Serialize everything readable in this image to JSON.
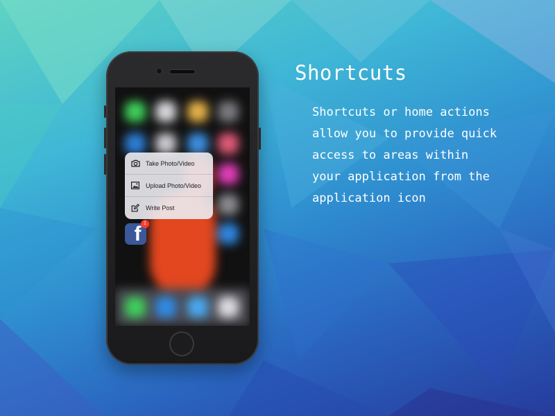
{
  "heading": {
    "title": "Shortcuts",
    "description_lines": [
      "Shortcuts or home actions",
      "allow you to provide quick",
      "access to areas within",
      "your application from the",
      "application icon"
    ]
  },
  "quick_actions": {
    "items": [
      {
        "label": "Take Photo/Video",
        "icon": "camera-icon"
      },
      {
        "label": "Upload Photo/Video",
        "icon": "photo-icon"
      },
      {
        "label": "Write Post",
        "icon": "compose-icon"
      }
    ]
  },
  "app_icon": {
    "icon": "facebook-app-icon",
    "letter": "f",
    "badge_count": "1",
    "brand_color": "#3b5998",
    "badge_color": "#ff3b30"
  }
}
